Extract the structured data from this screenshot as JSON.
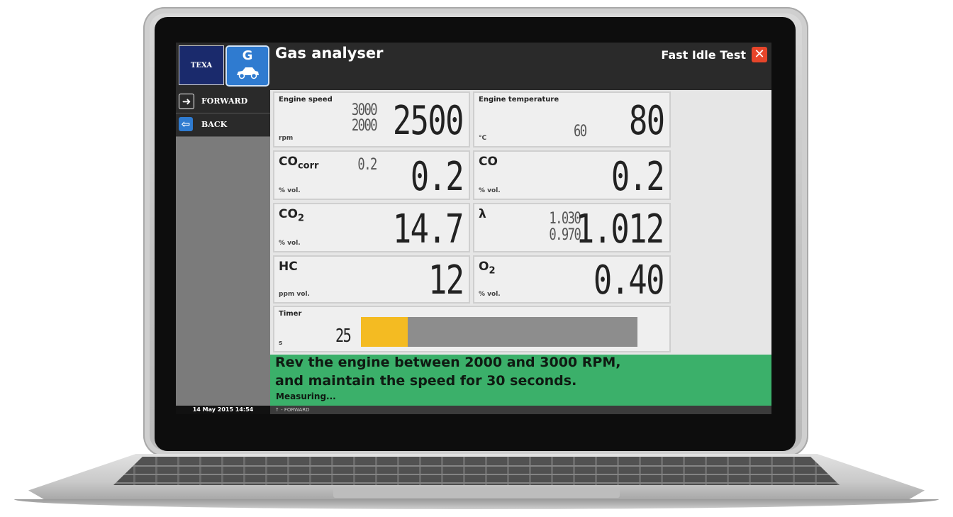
{
  "app": {
    "title": "Gas analyser",
    "test_name": "Fast Idle Test",
    "logo_texa": "TEXA",
    "logo_g": "G",
    "close_icon": "close-icon"
  },
  "sidebar": {
    "items": [
      {
        "label": "FORWARD",
        "icon": "arrow-right-icon",
        "color": "#2a2a2a"
      },
      {
        "label": "BACK",
        "icon": "arrow-left-icon",
        "color": "#2f7bd0"
      }
    ]
  },
  "status": {
    "datetime": "14 May 2015  14:54",
    "hint": "↑ - FORWARD"
  },
  "readings": {
    "engine_speed": {
      "label": "Engine speed",
      "unit": "rpm",
      "value": "2500",
      "max": "3000",
      "min": "2000"
    },
    "engine_temp": {
      "label": "Engine temperature",
      "unit": "°C",
      "value": "80",
      "min": "60"
    },
    "co_corr": {
      "label": "CO",
      "sub": "corr",
      "unit": "% vol.",
      "value": "0.2",
      "ref": "0.2"
    },
    "co": {
      "label": "CO",
      "unit": "% vol.",
      "value": "0.2"
    },
    "co2": {
      "label": "CO",
      "sub": "2",
      "unit": "% vol.",
      "value": "14.7"
    },
    "lambda": {
      "label": "λ",
      "value": "1.012",
      "max": "1.030",
      "min": "0.970"
    },
    "hc": {
      "label": "HC",
      "unit": "ppm vol.",
      "value": "12"
    },
    "o2": {
      "label": "O",
      "sub": "2",
      "unit": "% vol.",
      "value": "0.40"
    },
    "timer": {
      "label": "Timer",
      "unit": "s",
      "value": "25",
      "progress_fraction": 0.17
    }
  },
  "message": {
    "line1": "Rev the engine between 2000 and 3000 RPM,",
    "line2": "and maintain the speed for 30 seconds.",
    "line3": "Measuring..."
  },
  "colors": {
    "message_bg": "#3bb06a",
    "timer_fill": "#f4bb22",
    "close": "#e7452a"
  }
}
